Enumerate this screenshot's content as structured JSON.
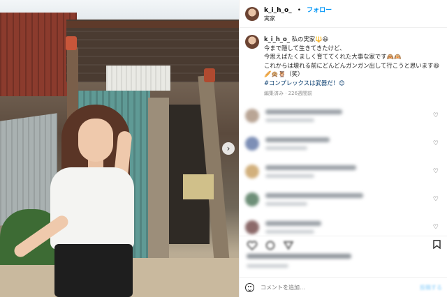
{
  "header": {
    "username": "k_i_h_o_",
    "separator": "•",
    "follow_label": "フォロー",
    "location": "実家"
  },
  "caption": {
    "username": "k_i_h_o_",
    "lines": [
      "私の実家🔱😆",
      "今まで隠して生きてきたけど、",
      "今思えばたくましく育ててくれた大事な家です🙈🙉",
      "これからは壊れる前にどんどんガンガン出して行こうと思います😆🥖🙊🦉（笑）",
      "#コンプレックスは武器だ！😊"
    ],
    "meta": "編集済み · 226週間前"
  },
  "comments": [
    {
      "avatar_color": "#b9a595",
      "l1w": 110,
      "l2w": 70
    },
    {
      "avatar_color": "#7d8fb6",
      "l1w": 92,
      "l2w": 60
    },
    {
      "avatar_color": "#d2b07c",
      "l1w": 130,
      "l2w": 70
    },
    {
      "avatar_color": "#6e8f78",
      "l1w": 140,
      "l2w": 60
    },
    {
      "avatar_color": "#8c6a6a",
      "l1w": 80,
      "l2w": 70
    }
  ],
  "actions": {
    "bookmark_icon": "bookmark-icon"
  },
  "add_comment": {
    "placeholder": "コメントを追加...",
    "post_label": "投稿する"
  },
  "colors": {
    "follow": "#0095f6",
    "hashtag": "#00376b",
    "post_button": "#b2dffc"
  }
}
